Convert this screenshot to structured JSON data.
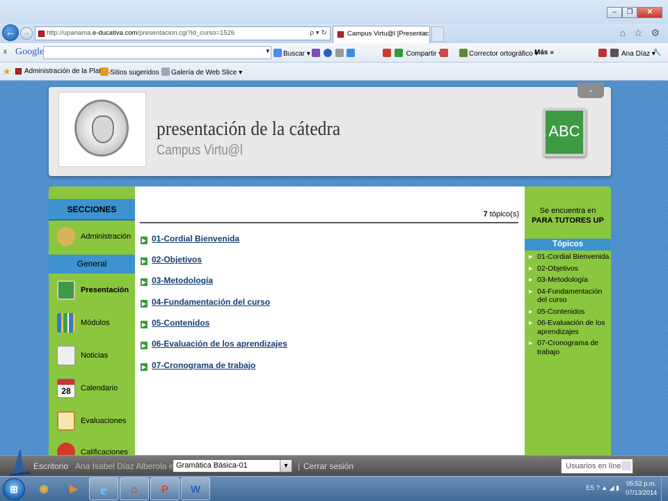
{
  "browser": {
    "url_prefix": "http://upanama.",
    "url_domain": "e-ducativa.com",
    "url_path": "/presentacion.cgi?id_curso=1526",
    "addr_icons": "ρ ▾ ↻",
    "tab_title": "Campus Virtu@l [Presentac...",
    "tab_close": "×",
    "back": "←",
    "forward": "→",
    "right_icons": "⌂ ☆ ⚙",
    "window_min": "–",
    "window_restore": "❐",
    "window_close": "✕"
  },
  "google_toolbar": {
    "close": "x",
    "logo": "Google",
    "search_value": "",
    "dropdown": "▾",
    "buscar": "Buscar ▾",
    "compartir": "Compartir ▾",
    "corrector": "Corrector ortográfico ▾",
    "mas": "Más »",
    "user": "Ana Díaz ▾"
  },
  "favorites_bar": {
    "items": [
      "Administración de la Plata...",
      "Sitios sugeridos ▾",
      "Galería de Web Slice ▾"
    ]
  },
  "header": {
    "title": "presentación de la cátedra",
    "subtitle": "Campus Virtu@l",
    "board_text": "ABC",
    "collapse": "⌄"
  },
  "left_sidebar": {
    "sections_title": "SECCIONES",
    "admin_label": "Administración",
    "general_title": "General",
    "items": [
      {
        "label": "Presentación",
        "icon": "abc-board-icon",
        "color": "#3f9a44"
      },
      {
        "label": "Módulos",
        "icon": "binders-icon",
        "color": "#3a78c0"
      },
      {
        "label": "Noticias",
        "icon": "newspaper-icon",
        "color": "#cfcfcf"
      },
      {
        "label": "Calendario",
        "icon": "calendar-icon",
        "color": "#f2f2f2"
      },
      {
        "label": "Evaluaciones",
        "icon": "clipboard-icon",
        "color": "#e7c35a"
      },
      {
        "label": "Calificaciones",
        "icon": "medal-icon",
        "color": "#d23a2a"
      }
    ],
    "calendar_day": "28"
  },
  "center": {
    "topic_count": "7",
    "topic_count_label": " tópico(s)",
    "topics": [
      "01-Cordial Bienvenida",
      "02-Objetivos",
      "03-Metodología",
      "04-Fundamentación del curso",
      "05-Contenidos",
      "06-Evaluación de los aprendizajes",
      "07-Cronograma de trabajo"
    ]
  },
  "right_sidebar": {
    "location_line1": "Se encuentra en",
    "location_line2": "PARA TUTORES UP",
    "topics_title": "Tópicos",
    "topics": [
      "01-Cordial Bienvenida",
      "02-Objetivos",
      "03-Metodología",
      "04-Fundamentación del curso",
      "05-Contenidos",
      "06-Evaluación de los aprendizajes",
      "07-Cronograma de trabajo"
    ]
  },
  "app_bar": {
    "desktop": "Escritorio",
    "user_in": "Ana Isabel Díaz Alberola en",
    "course_select": "Gramática Básica-01",
    "separator": "|",
    "logout": "Cerrar sesión",
    "online_placeholder": "Usuarios en línea"
  },
  "taskbar": {
    "start": "⊞",
    "apps": [
      {
        "name": "chrome",
        "glyph": "◉",
        "color": "#e3b23c"
      },
      {
        "name": "media",
        "glyph": "▶",
        "color": "#e58a2c"
      },
      {
        "name": "ie",
        "glyph": "e",
        "color": "#6fc2ff"
      },
      {
        "name": "acrobat",
        "glyph": "⌂",
        "color": "#d9251c"
      },
      {
        "name": "powerpoint",
        "glyph": "P",
        "color": "#d04a22"
      },
      {
        "name": "word",
        "glyph": "W",
        "color": "#2b5fb4"
      }
    ],
    "lang": "ES",
    "tray_icons": "? ▲ ◢ ▮",
    "time": "05:52 p.m.",
    "date": "07/13/2014"
  },
  "colors": {
    "green_panel": "#8bc63f",
    "blue_head": "#3c93cf",
    "link": "#153d73",
    "page_bg": "#4d8fcf"
  }
}
